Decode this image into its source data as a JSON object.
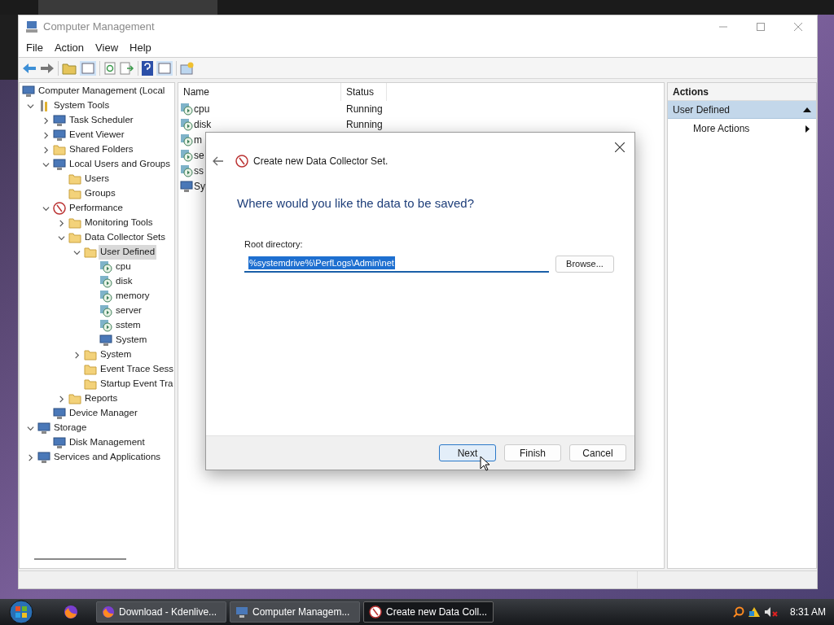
{
  "window": {
    "title": "Computer Management"
  },
  "menu": [
    "File",
    "Action",
    "View",
    "Help"
  ],
  "tree": [
    {
      "label": "Computer Management (Local",
      "kind": "node",
      "selected": false,
      "children": [
        {
          "label": "System Tools",
          "kind": "tools",
          "expanded": true,
          "selected": false,
          "children": [
            {
              "label": "Task Scheduler",
              "kind": "node",
              "expanded": false,
              "selected": false
            },
            {
              "label": "Event Viewer",
              "kind": "node",
              "expanded": false,
              "selected": false
            },
            {
              "label": "Shared Folders",
              "kind": "folder",
              "expanded": false,
              "selected": false
            },
            {
              "label": "Local Users and Groups",
              "kind": "node",
              "expanded": true,
              "selected": false,
              "children": [
                {
                  "label": "Users",
                  "kind": "folder",
                  "selected": false
                },
                {
                  "label": "Groups",
                  "kind": "folder",
                  "selected": false
                }
              ]
            },
            {
              "label": "Performance",
              "kind": "perf",
              "expanded": true,
              "selected": false,
              "children": [
                {
                  "label": "Monitoring Tools",
                  "kind": "folder",
                  "expanded": false,
                  "selected": false
                },
                {
                  "label": "Data Collector Sets",
                  "kind": "folder",
                  "expanded": true,
                  "selected": false,
                  "children": [
                    {
                      "label": "User Defined",
                      "kind": "folder",
                      "expanded": true,
                      "selected": true,
                      "children": [
                        {
                          "label": "cpu",
                          "kind": "collector",
                          "selected": false
                        },
                        {
                          "label": "disk",
                          "kind": "collector",
                          "selected": false
                        },
                        {
                          "label": "memory",
                          "kind": "collector",
                          "selected": false
                        },
                        {
                          "label": "server",
                          "kind": "collector",
                          "selected": false
                        },
                        {
                          "label": "sstem",
                          "kind": "collector",
                          "selected": false
                        },
                        {
                          "label": "System",
                          "kind": "node",
                          "selected": false
                        }
                      ]
                    },
                    {
                      "label": "System",
                      "kind": "folder",
                      "expanded": false,
                      "selected": false
                    },
                    {
                      "label": "Event Trace Sess",
                      "kind": "folder",
                      "selected": false
                    },
                    {
                      "label": "Startup Event Tra",
                      "kind": "folder",
                      "selected": false
                    }
                  ]
                },
                {
                  "label": "Reports",
                  "kind": "folder",
                  "expanded": false,
                  "selected": false
                }
              ]
            },
            {
              "label": "Device Manager",
              "kind": "node",
              "selected": false
            }
          ]
        },
        {
          "label": "Storage",
          "kind": "node",
          "expanded": true,
          "selected": false,
          "children": [
            {
              "label": "Disk Management",
              "kind": "node",
              "selected": false
            }
          ]
        },
        {
          "label": "Services and Applications",
          "kind": "node",
          "expanded": false,
          "selected": false
        }
      ]
    }
  ],
  "list": {
    "columns": [
      "Name",
      "Status"
    ],
    "rows": [
      {
        "name": "cpu",
        "status": "Running",
        "kind": "collector"
      },
      {
        "name": "disk",
        "status": "Running",
        "kind": "collector"
      },
      {
        "name": "m",
        "kind": "collector"
      },
      {
        "name": "se",
        "kind": "collector"
      },
      {
        "name": "ss",
        "kind": "collector"
      },
      {
        "name": "Sy",
        "kind": "node"
      }
    ]
  },
  "actions": {
    "title": "Actions",
    "section": {
      "label": "User Defined",
      "expanded": true
    },
    "items": [
      "More Actions"
    ]
  },
  "dialog": {
    "title": "Create new Data Collector Set.",
    "heading": "Where would you like the data to be saved?",
    "field_label": "Root directory:",
    "field_value": "%systemdrive%\\PerfLogs\\Admin\\net",
    "browse": "Browse...",
    "buttons": [
      {
        "label": "Next",
        "default": true
      },
      {
        "label": "Finish",
        "default": false
      },
      {
        "label": "Cancel",
        "default": false
      }
    ]
  },
  "taskbar": {
    "tasks": [
      {
        "label": "Download - Kdenlive...",
        "selected": false
      },
      {
        "label": "Computer Managem...",
        "selected": false
      },
      {
        "label": "Create new Data Coll...",
        "selected": true
      }
    ],
    "clock": "8:31 AM"
  }
}
